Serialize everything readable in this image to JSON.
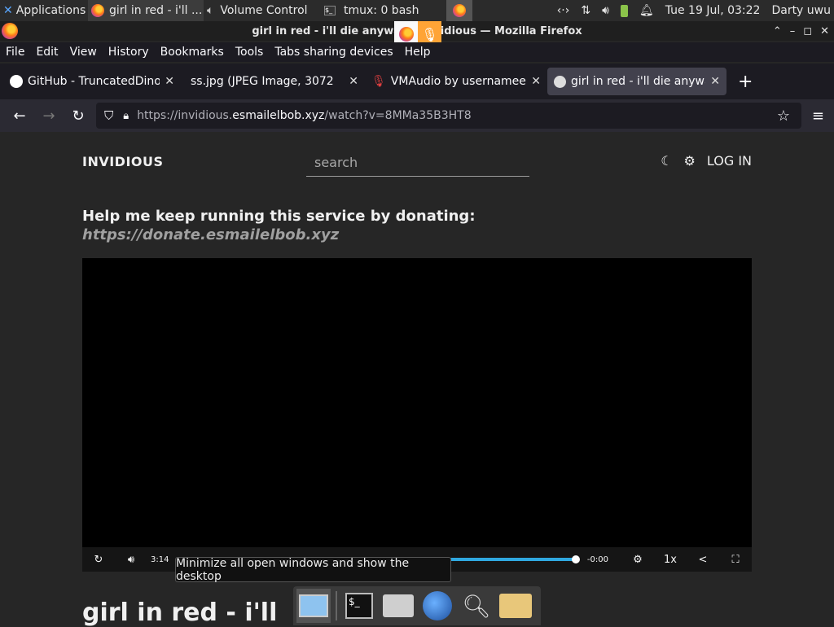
{
  "panel": {
    "applications": "Applications",
    "tasks": [
      {
        "label": "girl in red - i'll ...",
        "icon": "firefox-icon"
      },
      {
        "label": "Volume Control",
        "icon": "speaker-icon"
      },
      {
        "label": "tmux: 0 bash",
        "icon": "terminal-icon"
      }
    ],
    "datetime": "Tue 19 Jul, 03:22",
    "user": "Darty uwu"
  },
  "window": {
    "title": "girl in red - i'll die anyway. - Invidious — Mozilla Firefox"
  },
  "menu": [
    "File",
    "Edit",
    "View",
    "History",
    "Bookmarks",
    "Tools",
    "Tabs sharing devices",
    "Help"
  ],
  "tabs": [
    {
      "label": "GitHub - TruncatedDinos",
      "icon": "github-icon",
      "active": false
    },
    {
      "label": "ss.jpg (JPEG Image, 3072",
      "icon": "",
      "active": false
    },
    {
      "label": "VMAudio by usernamee",
      "icon": "microphone-icon",
      "active": false
    },
    {
      "label": "girl in red - i'll die anyway",
      "icon": "invidious-icon",
      "active": true
    }
  ],
  "url": {
    "prefix": "https://invidious.",
    "host": "esmailelbob.xyz",
    "path": "/watch?v=8MMa35B3HT8"
  },
  "page": {
    "brand": "INVIDIOUS",
    "search_placeholder": "search",
    "login": "LOG IN",
    "donate_text": "Help me keep running this service by donating:",
    "donate_link": "https://donate.esmailelbob.xyz",
    "video_title": "girl in red - i'll"
  },
  "player": {
    "current_time": "3:14",
    "remaining": "-0:00",
    "speed": "1x",
    "progress": 1.0
  },
  "tooltip": "Minimize all open windows and show the desktop",
  "colors": {
    "accent": "#2fa8e0",
    "sharing": "#ffa436"
  }
}
